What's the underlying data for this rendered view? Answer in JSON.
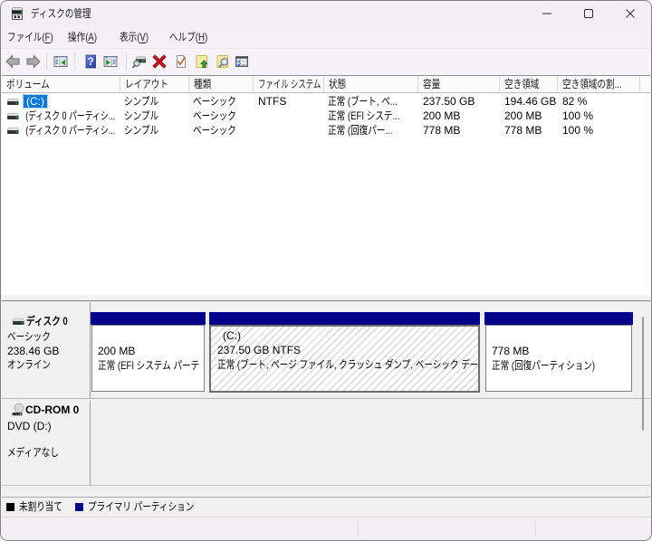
{
  "window": {
    "title": "ディスクの管理"
  },
  "menu": {
    "items": [
      {
        "pre": "ファイル(",
        "mnemonic": "F",
        "post": ")"
      },
      {
        "pre": "操作(",
        "mnemonic": "A",
        "post": ")"
      },
      {
        "pre": "表示(",
        "mnemonic": "V",
        "post": ")"
      },
      {
        "pre": "ヘルプ(",
        "mnemonic": "H",
        "post": ")"
      }
    ]
  },
  "toolbar": {
    "icons": [
      "back-arrow",
      "forward-arrow",
      "show-console-tree",
      "help",
      "show-action-pane",
      "rescan-disks",
      "delete-volume",
      "check-document",
      "open",
      "explore",
      "properties"
    ]
  },
  "volume_list": {
    "columns": [
      "ボリューム",
      "レイアウト",
      "種類",
      "ファイル システム",
      "状態",
      "容量",
      "空き領域",
      "空き領域の割..."
    ],
    "rows": [
      {
        "volume": "(C:)",
        "layout": "シンプル",
        "type": "ベーシック",
        "filesystem": "NTFS",
        "status": "正常 (ブート, ペ...",
        "capacity": "237.50 GB",
        "free_space": "194.46 GB",
        "free_percent": "82 %",
        "selected": true
      },
      {
        "volume": "(ディスク 0 パーティシ...",
        "layout": "シンプル",
        "type": "ベーシック",
        "filesystem": "",
        "status": "正常 (EFI システ...",
        "capacity": "200 MB",
        "free_space": "200 MB",
        "free_percent": "100 %",
        "selected": false
      },
      {
        "volume": "(ディスク 0 パーティシ...",
        "layout": "シンプル",
        "type": "ベーシック",
        "filesystem": "",
        "status": "正常 (回復パー...",
        "capacity": "778 MB",
        "free_space": "778 MB",
        "free_percent": "100 %",
        "selected": false
      }
    ]
  },
  "graphical_view": {
    "disk0": {
      "name": "ディスク 0",
      "type": "ベーシック",
      "size": "238.46 GB",
      "status": "オンライン",
      "partitions": [
        {
          "label": "",
          "size": "200 MB",
          "status": "正常 (EFI システム パーテ",
          "selected": false
        },
        {
          "label": "(C:)",
          "size": "237.50 GB NTFS",
          "status": "正常 (ブート, ページ ファイル, クラッシュ ダンプ, ベーシック データ",
          "selected": true
        },
        {
          "label": "",
          "size": "778 MB",
          "status": "正常 (回復パーティション)",
          "selected": false
        }
      ]
    },
    "cdrom0": {
      "name": "CD-ROM 0",
      "media": "DVD (D:)",
      "status": "メディアなし"
    }
  },
  "legend": {
    "items": [
      {
        "label": "未割り当て",
        "color": "#000000"
      },
      {
        "label": "プライマリ パーティション",
        "color": "#00008B"
      }
    ]
  },
  "colors": {
    "selection": "#0078D7",
    "primary_partition": "#00008B"
  }
}
